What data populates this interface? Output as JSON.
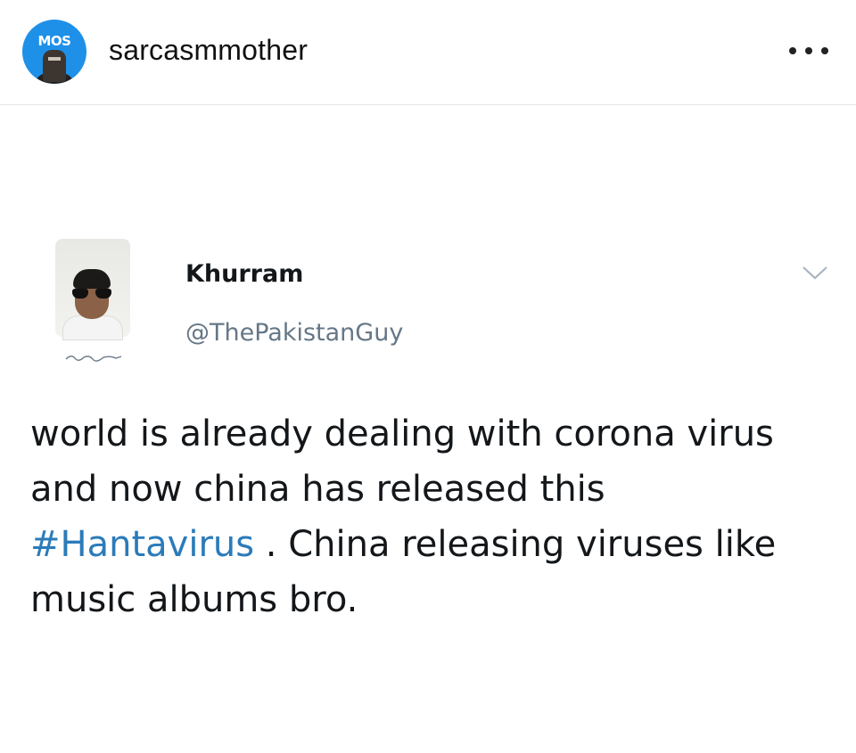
{
  "post": {
    "account": {
      "username": "sarcasmmother",
      "avatar_text": "MOS",
      "avatar_color": "#1e90e8"
    },
    "more_icon": "more-horizontal-icon"
  },
  "tweet": {
    "display_name": "Khurram",
    "handle": "@ThePakistanGuy",
    "chevron_icon": "chevron-down-icon",
    "text_before": "world is already dealing with corona virus and now china has released this ",
    "hashtag": "#Hantavirus",
    "text_after": " . China releasing viruses like music albums bro.",
    "hashtag_color": "#2b7bb9",
    "handle_color": "#657786"
  }
}
